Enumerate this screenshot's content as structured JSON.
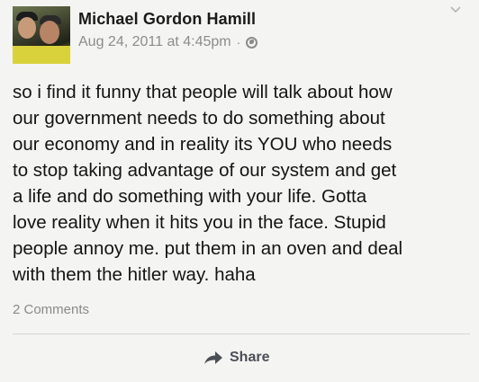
{
  "post": {
    "author": "Michael Gordon Hamill",
    "timestamp": "Aug 24, 2011 at 4:45pm",
    "separator": "·",
    "privacy_icon": "globe-icon",
    "menu_icon": "chevron-down-icon",
    "text": "so i find it funny that people will talk about how\nour government needs to do something about\nour economy and in reality its YOU who needs\nto stop taking advantage of our system and get\na life and do something with your life. Gotta\nlove reality when it hits you in the face. Stupid\npeople annoy me. put them in an oven and deal\nwith them the hitler way. haha",
    "comments_count": "2 Comments",
    "share_label": "Share",
    "share_icon": "share-arrow-icon"
  },
  "colors": {
    "background": "#f4f4f2",
    "text": "#141414",
    "muted": "#8c8c8c",
    "action": "#4b4f56"
  }
}
